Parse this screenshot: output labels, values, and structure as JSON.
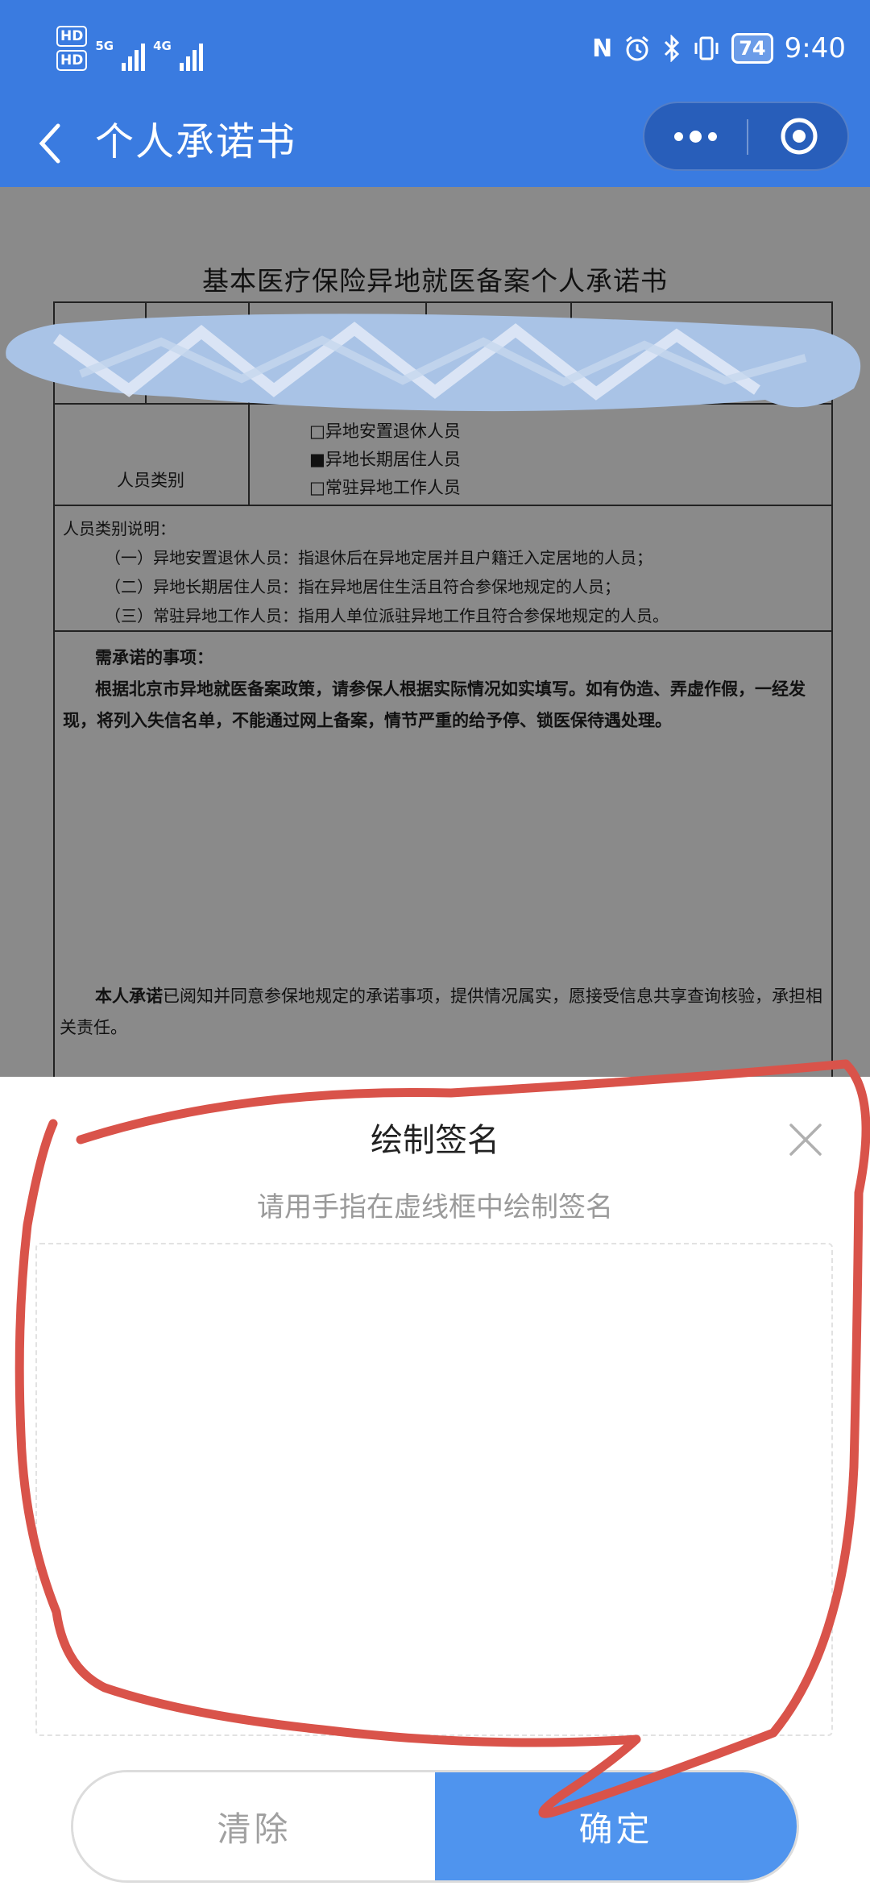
{
  "status_bar": {
    "hd1": "HD",
    "hd2": "HD",
    "sim1_network": "5G",
    "sim2_network": "4G",
    "nfc_icon": "N",
    "alarm_icon": "alarm-icon",
    "bluetooth_icon": "bluetooth-icon",
    "vibrate_icon": "vibrate-icon",
    "battery": "74",
    "time": "9:40"
  },
  "nav": {
    "title": "个人承诺书",
    "back_icon": "chevron-left-icon",
    "more_icon": "more-dots-icon",
    "close_icon": "target-close-icon"
  },
  "document": {
    "title": "基本医疗保险异地就医备案个人承诺书",
    "category_label": "人员类别",
    "category_options": [
      {
        "mark": "□",
        "text": "异地安置退休人员"
      },
      {
        "mark": "■",
        "text": "异地长期居住人员"
      },
      {
        "mark": "□",
        "text": "常驻异地工作人员"
      }
    ],
    "notes_title": "人员类别说明：",
    "notes": [
      "（一）异地安置退休人员：指退休后在异地定居并且户籍迁入定居地的人员；",
      "（二）异地长期居住人员：指在异地居住生活且符合参保地规定的人员；",
      "（三）常驻异地工作人员：指用人单位派驻异地工作且符合参保地规定的人员。"
    ],
    "pledge_title": "需承诺的事项：",
    "pledge_text": "根据北京市异地就医备案政策，请参保人根据实际情况如实填写。如有伪造、弄虚作假，一经发现，将列入失信名单，不能通过网上备案，情节严重的给予停、锁医保待遇处理。",
    "commit_bold": "本人承诺",
    "commit_text": "已阅知并同意参保地规定的承诺事项，提供情况属实，愿接受信息共享查询核验，承担相关责任。"
  },
  "signature": {
    "title": "绘制签名",
    "hint": "请用手指在虚线框中绘制签名",
    "close_icon": "close-icon",
    "clear_label": "清除",
    "confirm_label": "确定"
  },
  "colors": {
    "header_blue": "#3a7be0",
    "confirm_blue": "#4f94ee",
    "annotation_red": "#d9534a",
    "dim_overlay": "#8a8a8a"
  }
}
